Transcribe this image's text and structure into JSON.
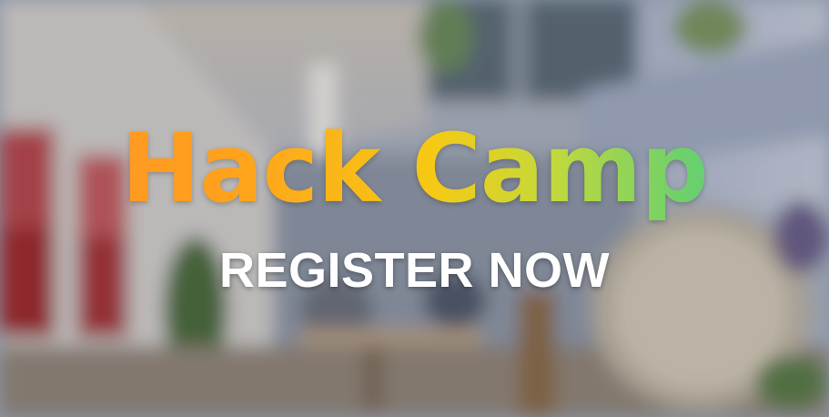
{
  "banner": {
    "headline": "Hack Camp",
    "cta_label": "REGISTER NOW"
  },
  "colors": {
    "headline_gradient": [
      "#ff8f2a",
      "#ffa21c",
      "#f6c914",
      "#c6d93a",
      "#6fd06a",
      "#3fd39a"
    ],
    "cta_text": "#ffffff"
  }
}
